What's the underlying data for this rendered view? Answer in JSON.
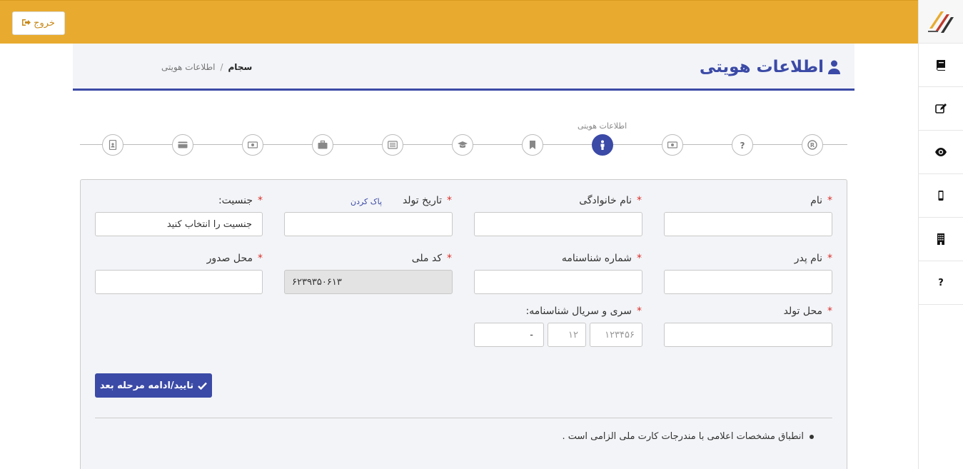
{
  "topbar": {
    "logout_label": "خروج"
  },
  "sidebar": {
    "items": [
      {
        "name": "book"
      },
      {
        "name": "edit"
      },
      {
        "name": "eye"
      },
      {
        "name": "mobile"
      },
      {
        "name": "building"
      },
      {
        "name": "help",
        "label": "?"
      }
    ]
  },
  "header": {
    "title": "اطلاعات هویتی",
    "breadcrumb": {
      "home": "سجام",
      "separator": "/",
      "current": "اطلاعات هویتی"
    }
  },
  "stepper": {
    "active_label": "اطلاعات هویتی"
  },
  "form": {
    "first_name_label": "نام",
    "last_name_label": "نام خانوادگی",
    "birth_date_label": "تاریخ تولد",
    "clear_label": "پاک کردن",
    "gender_label": "جنسیت:",
    "gender_value": "جنسیت را انتخاب کنید",
    "father_name_label": "نام پدر",
    "id_number_label": "شماره شناسنامه",
    "national_code_label": "کد ملی",
    "national_code_value": "۶۲۳۹۳۵۰۶۱۳",
    "issue_place_label": "محل صدور",
    "birth_place_label": "محل تولد",
    "serial_label": "سری و سریال شناسنامه:",
    "serial_number_placeholder": "۱۲۳۴۵۶",
    "serial_series_placeholder": "۱۲",
    "serial_letter_value": "-",
    "required_mark": "*"
  },
  "actions": {
    "confirm_label": "تایید/ادامه مرحله بعد"
  },
  "notes": [
    "انطباق مشخصات اعلامی با مندرجات کارت ملی الزامی است ."
  ],
  "colors": {
    "accent": "#3b4aa6",
    "topbar": "#e8ab2f",
    "required": "#d9302c"
  }
}
